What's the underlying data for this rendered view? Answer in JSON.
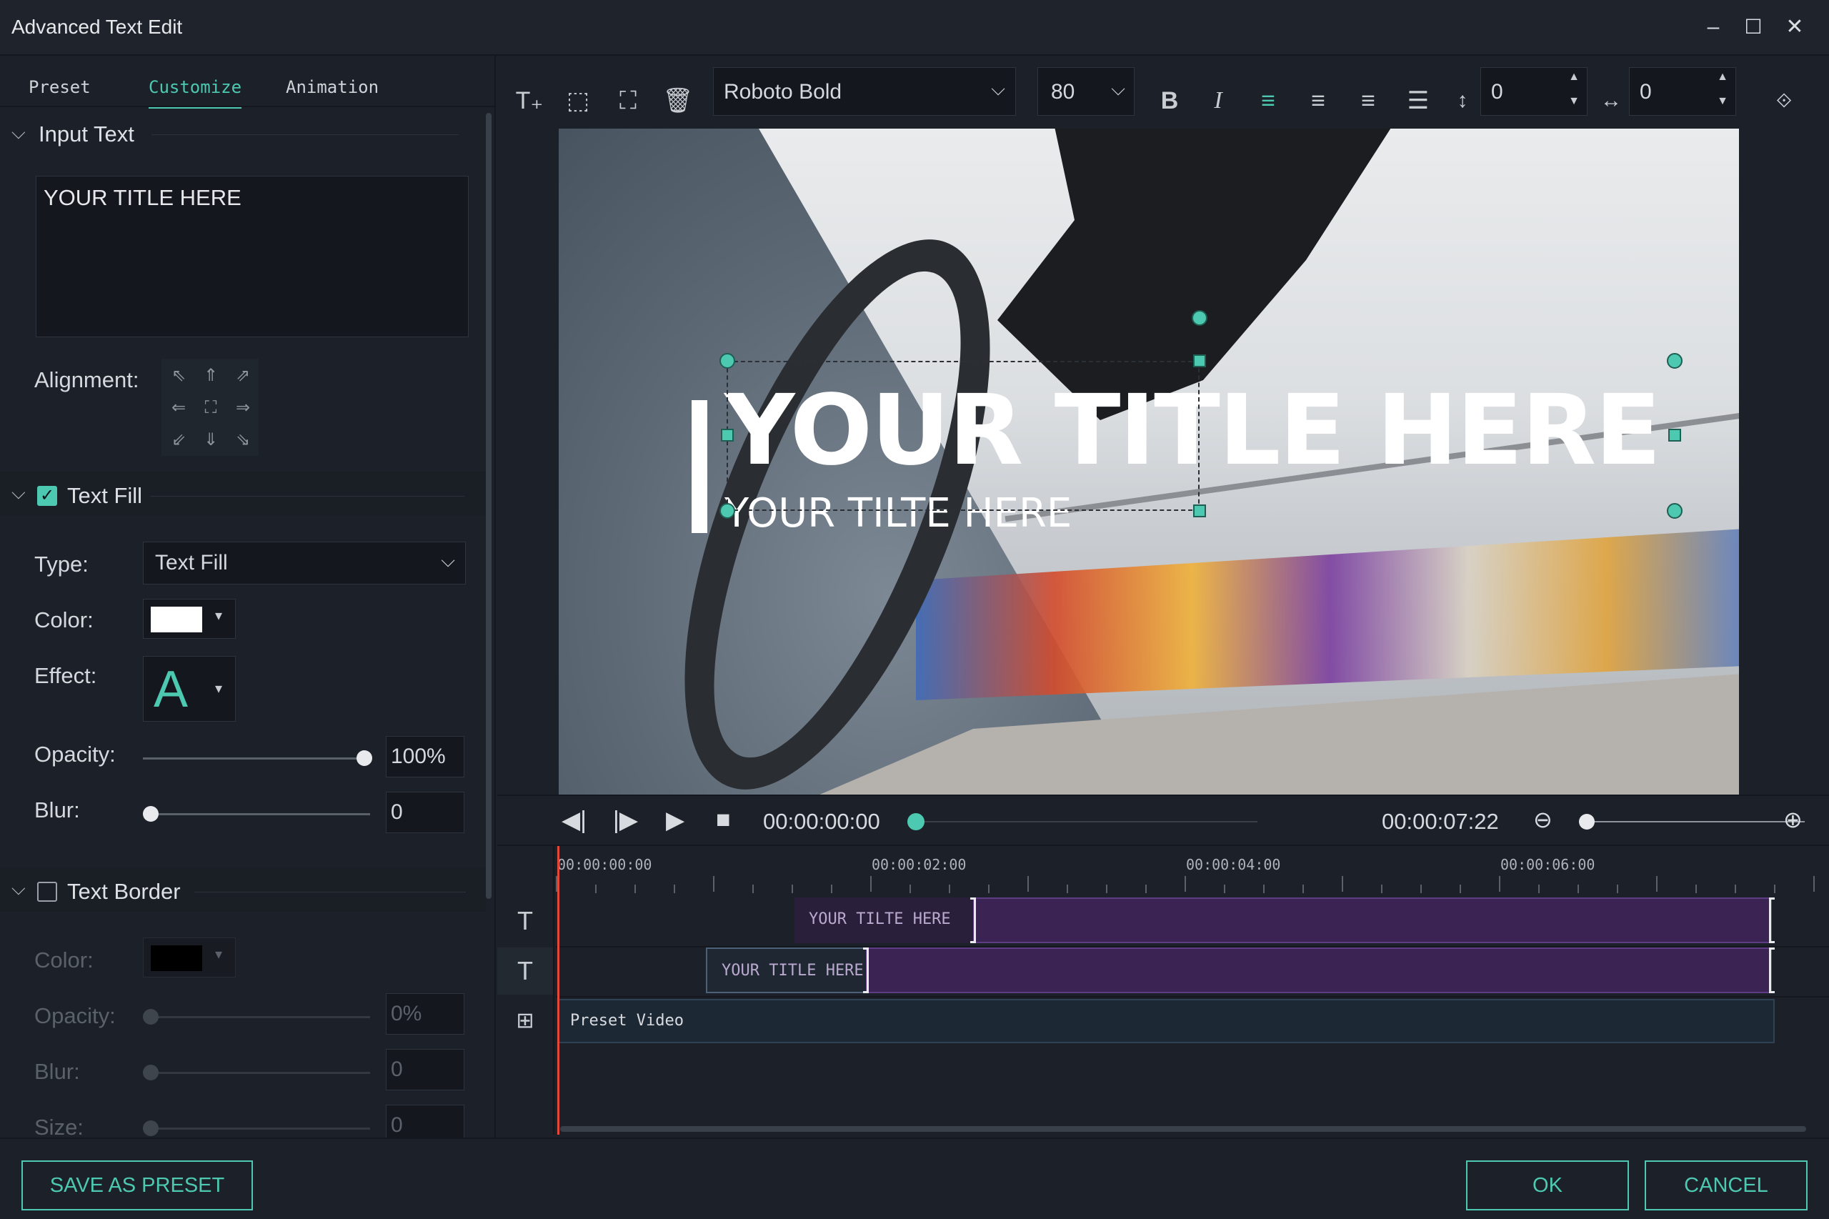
{
  "window": {
    "title": "Advanced Text Edit",
    "controls": {
      "minimize": "–",
      "maximize": "☐",
      "close": "✕"
    }
  },
  "tabs": [
    {
      "label": "Preset",
      "active": false
    },
    {
      "label": "Customize",
      "active": true
    },
    {
      "label": "Animation",
      "active": false
    }
  ],
  "input_text": {
    "section_title": "Input Text",
    "value": "YOUR TITLE HERE",
    "alignment_label": "Alignment:"
  },
  "text_fill": {
    "section_title": "Text Fill",
    "checked": true,
    "type_label": "Type:",
    "type_value": "Text Fill",
    "color_label": "Color:",
    "color_value": "#ffffff",
    "effect_label": "Effect:",
    "effect_glyph": "A",
    "opacity_label": "Opacity:",
    "opacity_value": "100%",
    "opacity_fraction": 1.0,
    "blur_label": "Blur:",
    "blur_value": "0",
    "blur_fraction": 0.0
  },
  "text_border": {
    "section_title": "Text Border",
    "checked": false,
    "color_label": "Color:",
    "color_value": "#000000",
    "opacity_label": "Opacity:",
    "opacity_value": "0%",
    "blur_label": "Blur:",
    "blur_value": "0",
    "size_label": "Size:",
    "size_value": "0"
  },
  "toolbar": {
    "font_value": "Roboto Bold",
    "size_value": "80",
    "bold_glyph": "B",
    "italic_glyph": "I",
    "line_spacing_value": "0",
    "char_spacing_value": "0"
  },
  "preview": {
    "title_main": "YOUR TITLE HERE",
    "title_sub": "YOUR TILTE HERE"
  },
  "playback": {
    "current_time": "00:00:00:00",
    "total_time": "00:00:07:22"
  },
  "timeline": {
    "ruler_labels": [
      "00:00:00:00",
      "00:00:02:00",
      "00:00:04:00",
      "00:00:06:00"
    ],
    "tracks": [
      {
        "clip_label": "YOUR TILTE HERE"
      },
      {
        "clip_label": "YOUR TITLE HERE"
      },
      {
        "clip_label": "Preset Video"
      }
    ]
  },
  "footer": {
    "save_preset_label": "SAVE AS PRESET",
    "ok_label": "OK",
    "cancel_label": "CANCEL"
  },
  "colors": {
    "accent": "#4cc9b0",
    "background": "#1c2129",
    "clip_purple": "#3b2454",
    "playhead": "#e2473c"
  }
}
